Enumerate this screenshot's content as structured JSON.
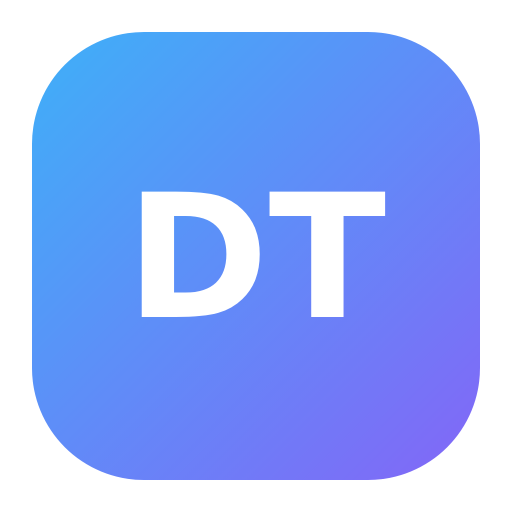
{
  "icon": {
    "text": "DT",
    "text_color": "#ffffff",
    "gradient_start": "#3eb0f8",
    "gradient_end": "#8366f7"
  },
  "page": {
    "background": "#ffffff"
  }
}
